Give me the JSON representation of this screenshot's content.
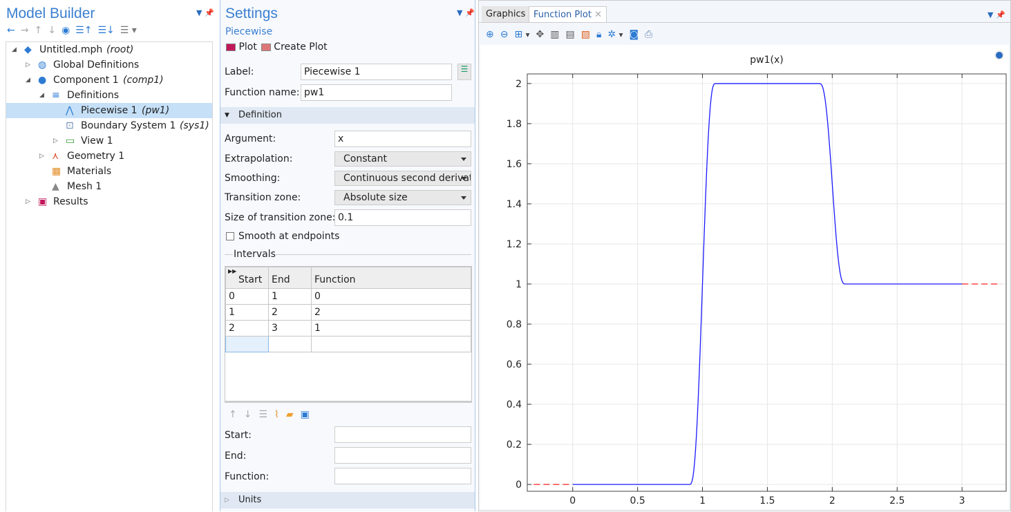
{
  "model_builder": {
    "title": "Model Builder",
    "toolbar": [
      "back-arrow-icon",
      "forward-arrow-icon",
      "move-up-icon",
      "move-down-icon",
      "show-icon",
      "collapse-all-icon",
      "expand-all-icon",
      "list-options-icon"
    ],
    "tree": [
      {
        "label": "Untitled.mph",
        "tag": "(root)",
        "icon": "file-icon"
      },
      {
        "label": "Global Definitions",
        "tag": "",
        "icon": "globe-icon"
      },
      {
        "label": "Component 1",
        "tag": "(comp1)",
        "icon": "component-icon"
      },
      {
        "label": "Definitions",
        "tag": "",
        "icon": "definitions-icon"
      },
      {
        "label": "Piecewise 1",
        "tag": "(pw1)",
        "icon": "piecewise-icon"
      },
      {
        "label": "Boundary System 1",
        "tag": "(sys1)",
        "icon": "boundary-system-icon"
      },
      {
        "label": "View 1",
        "tag": "",
        "icon": "view-icon"
      },
      {
        "label": "Geometry 1",
        "tag": "",
        "icon": "geometry-icon"
      },
      {
        "label": "Materials",
        "tag": "",
        "icon": "materials-icon"
      },
      {
        "label": "Mesh 1",
        "tag": "",
        "icon": "mesh-icon"
      },
      {
        "label": "Results",
        "tag": "",
        "icon": "results-icon"
      }
    ]
  },
  "settings": {
    "title": "Settings",
    "subtitle": "Piecewise",
    "plot": "Plot",
    "create_plot": "Create Plot",
    "label_lbl": "Label:",
    "label_val": "Piecewise 1",
    "fname_lbl": "Function name:",
    "fname_val": "pw1",
    "definition": "Definition",
    "argument_lbl": "Argument:",
    "argument_val": "x",
    "extrap_lbl": "Extrapolation:",
    "extrap_val": "Constant",
    "smooth_lbl": "Smoothing:",
    "smooth_val": "Continuous second derivative",
    "tz_lbl": "Transition zone:",
    "tz_val": "Absolute size",
    "tzsize_lbl": "Size of transition zone:",
    "tzsize_val": "0.1",
    "endpoints_lbl": "Smooth at endpoints",
    "endpoints_checked": false,
    "intervals": "Intervals",
    "columns": [
      "Start",
      "End",
      "Function"
    ],
    "rows": [
      [
        "0",
        "1",
        "0"
      ],
      [
        "1",
        "2",
        "2"
      ],
      [
        "2",
        "3",
        "1"
      ]
    ],
    "start_lbl": "Start:",
    "end_lbl": "End:",
    "function_lbl": "Function:",
    "start_val": "",
    "end_val": "",
    "function_val": "",
    "units": "Units"
  },
  "graphics": {
    "tabs": [
      "Graphics",
      "Function Plot"
    ],
    "active_tab": "Function Plot"
  },
  "chart_data": {
    "type": "line",
    "title": "pw1(x)",
    "xlim": [
      -0.35,
      3.34
    ],
    "ylim": [
      -0.034,
      2.048
    ],
    "xticks": [
      "0",
      "0.5",
      "1",
      "1.5",
      "2",
      "2.5",
      "3"
    ],
    "yticks": [
      "0",
      "0.2",
      "0.4",
      "0.6",
      "0.8",
      "1",
      "1.2",
      "1.4",
      "1.6",
      "1.8",
      "2"
    ],
    "grid": true,
    "series": [
      {
        "color": "#1a1aff",
        "x": [
          0,
          0.9,
          1.1,
          1.9,
          2.1,
          3
        ],
        "y": [
          0,
          0,
          2,
          2,
          1,
          1
        ]
      },
      {
        "color": "#ff2020",
        "style": "dashed",
        "x": [
          -0.3,
          0
        ],
        "y": [
          0,
          0
        ]
      },
      {
        "color": "#ff2020",
        "style": "dashed",
        "x": [
          3,
          3.3
        ],
        "y": [
          1,
          1
        ]
      }
    ]
  }
}
